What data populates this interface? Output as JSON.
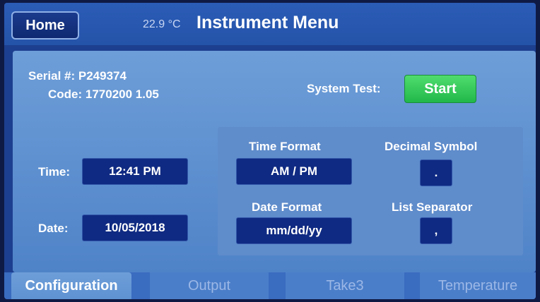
{
  "header": {
    "home_label": "Home",
    "temperature": "22.9 °C",
    "title": "Instrument Menu"
  },
  "device": {
    "serial": "Serial #: P249374",
    "code": "Code: 1770200  1.05"
  },
  "system_test": {
    "label": "System Test:",
    "button_label": "Start"
  },
  "datetime": {
    "time_label": "Time:",
    "time_value": "12:41 PM",
    "date_label": "Date:",
    "date_value": "10/05/2018"
  },
  "formats": {
    "time_format_label": "Time Format",
    "time_format_value": "AM / PM",
    "date_format_label": "Date Format",
    "date_format_value": "mm/dd/yy",
    "decimal_symbol_label": "Decimal Symbol",
    "decimal_symbol_value": ".",
    "list_separator_label": "List Separator",
    "list_separator_value": ","
  },
  "tabs": [
    {
      "label": "Configuration",
      "active": true
    },
    {
      "label": "Output",
      "active": false
    },
    {
      "label": "Take3",
      "active": false
    },
    {
      "label": "Temperature",
      "active": false
    }
  ],
  "colors": {
    "header": "#2453a9",
    "panel": "#5f8ccb",
    "field": "#0f2a82",
    "start_button": "#22b84a"
  }
}
